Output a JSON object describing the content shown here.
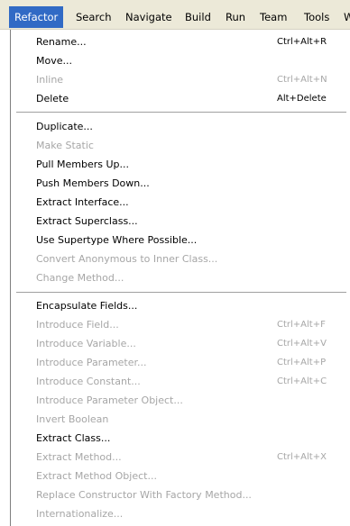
{
  "menubar": {
    "items": [
      {
        "id": "refactor",
        "label": "Refactor",
        "active": true
      },
      {
        "id": "search",
        "label": "Search"
      },
      {
        "id": "navigate",
        "label": "Navigate"
      },
      {
        "id": "build",
        "label": "Build"
      },
      {
        "id": "run",
        "label": "Run"
      },
      {
        "id": "team",
        "label": "Team"
      },
      {
        "id": "tools",
        "label": "Tools"
      },
      {
        "id": "window",
        "label": "W"
      }
    ]
  },
  "menu": {
    "items": [
      {
        "label": "Rename...",
        "shortcut": "Ctrl+Alt+R",
        "enabled": true
      },
      {
        "label": "Move...",
        "shortcut": "",
        "enabled": true
      },
      {
        "label": "Inline",
        "shortcut": "Ctrl+Alt+N",
        "enabled": false
      },
      {
        "label": "Delete",
        "shortcut": "Alt+Delete",
        "enabled": true
      },
      {
        "label": "Duplicate...",
        "shortcut": "",
        "enabled": true
      },
      {
        "label": "Make Static",
        "shortcut": "",
        "enabled": false
      },
      {
        "label": "Pull Members Up...",
        "shortcut": "",
        "enabled": true
      },
      {
        "label": "Push Members Down...",
        "shortcut": "",
        "enabled": true
      },
      {
        "label": "Extract Interface...",
        "shortcut": "",
        "enabled": true
      },
      {
        "label": "Extract Superclass...",
        "shortcut": "",
        "enabled": true
      },
      {
        "label": "Use Supertype Where Possible...",
        "shortcut": "",
        "enabled": true
      },
      {
        "label": "Convert Anonymous to Inner Class...",
        "shortcut": "",
        "enabled": false
      },
      {
        "label": "Change Method...",
        "shortcut": "",
        "enabled": false
      },
      {
        "label": "Encapsulate Fields...",
        "shortcut": "",
        "enabled": true
      },
      {
        "label": "Introduce Field...",
        "shortcut": "Ctrl+Alt+F",
        "enabled": false
      },
      {
        "label": "Introduce Variable...",
        "shortcut": "Ctrl+Alt+V",
        "enabled": false
      },
      {
        "label": "Introduce Parameter...",
        "shortcut": "Ctrl+Alt+P",
        "enabled": false
      },
      {
        "label": "Introduce Constant...",
        "shortcut": "Ctrl+Alt+C",
        "enabled": false
      },
      {
        "label": "Introduce Parameter Object...",
        "shortcut": "",
        "enabled": false
      },
      {
        "label": "Invert Boolean",
        "shortcut": "",
        "enabled": false
      },
      {
        "label": "Extract Class...",
        "shortcut": "",
        "enabled": true
      },
      {
        "label": "Extract Method...",
        "shortcut": "Ctrl+Alt+X",
        "enabled": false
      },
      {
        "label": "Extract Method Object...",
        "shortcut": "",
        "enabled": false
      },
      {
        "label": "Replace Constructor With Factory Method...",
        "shortcut": "",
        "enabled": false
      },
      {
        "label": "Internationalize...",
        "shortcut": "",
        "enabled": false
      }
    ]
  },
  "colors": {
    "menubar_bg": "#ece9d8",
    "active_bg": "#316ac5",
    "disabled_text": "#a6a6a6",
    "separator": "#a0a0a0"
  }
}
